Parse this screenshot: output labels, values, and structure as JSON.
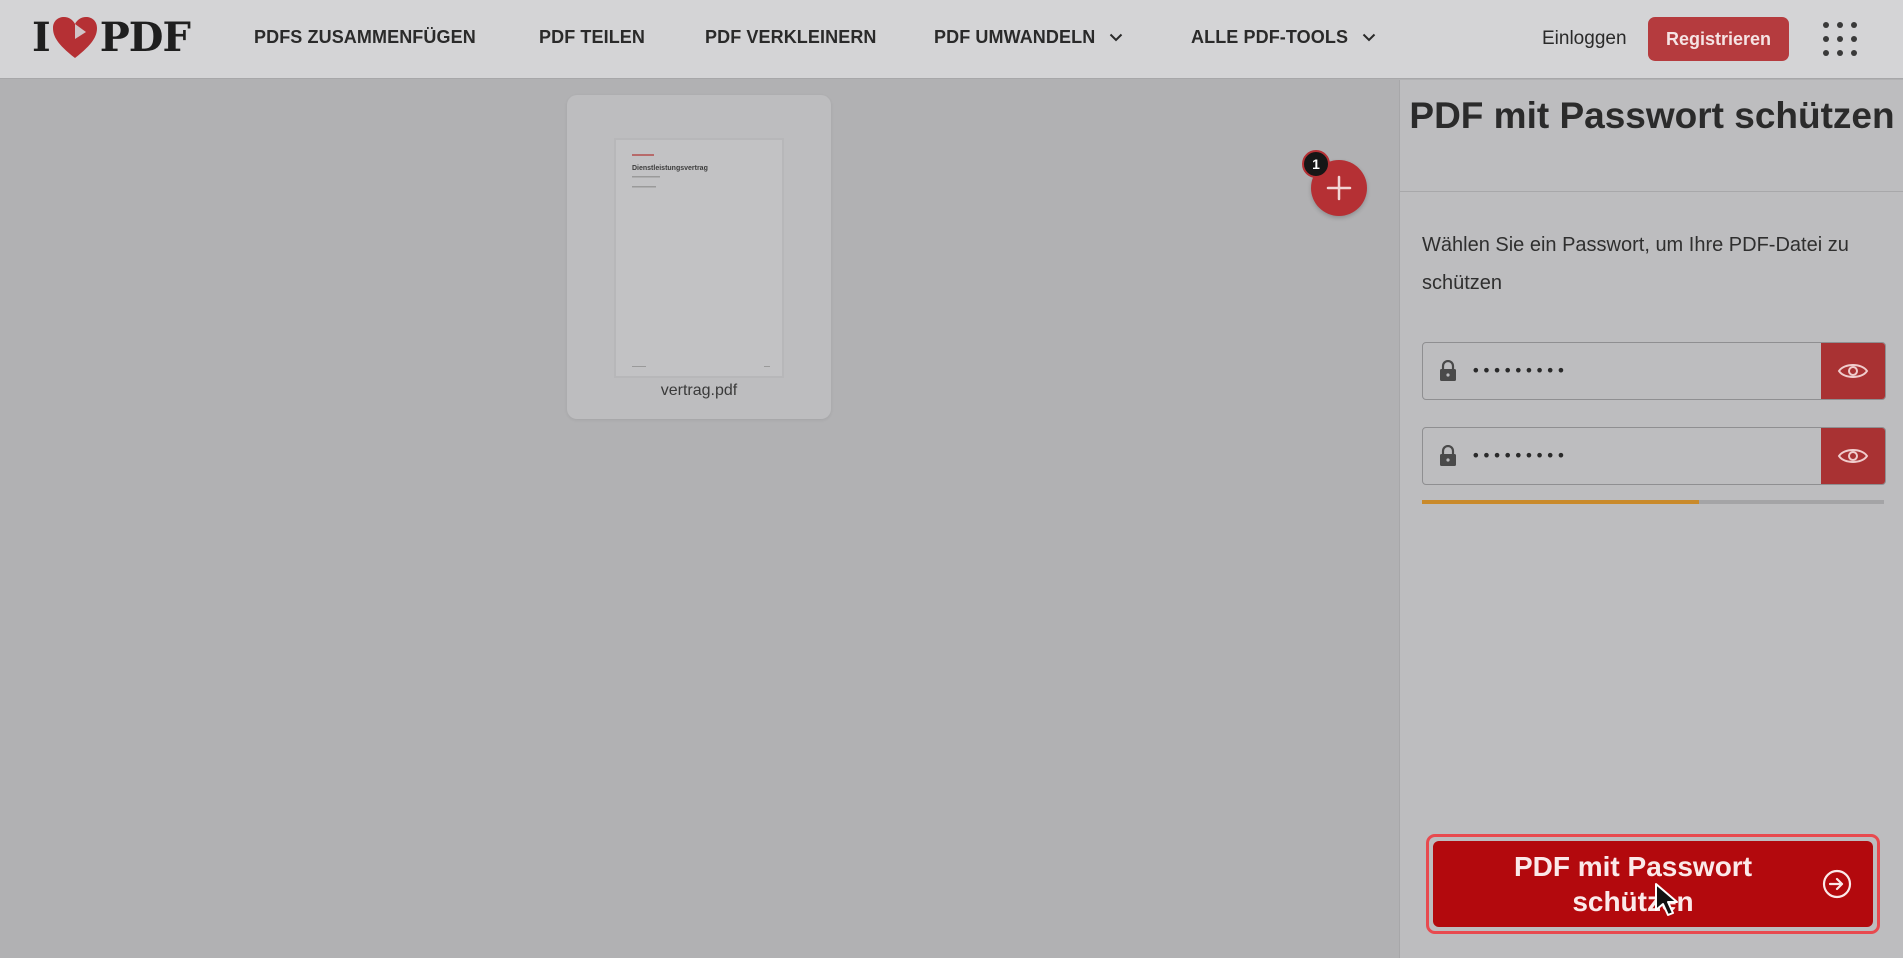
{
  "header": {
    "logo": {
      "left": "I",
      "right": "PDF"
    },
    "nav": [
      {
        "label": "PDFS ZUSAMMENFÜGEN"
      },
      {
        "label": "PDF TEILEN"
      },
      {
        "label": "PDF VERKLEINERN"
      },
      {
        "label": "PDF UMWANDELN"
      },
      {
        "label": "ALLE PDF-TOOLS"
      }
    ],
    "login_label": "Einloggen",
    "register_label": "Registrieren"
  },
  "workarea": {
    "file": {
      "name": "vertrag.pdf",
      "thumbnail_title": "Dienstleistungsvertrag"
    },
    "add_badge_count": "1"
  },
  "sidebar": {
    "title": "PDF mit Passwort schützen",
    "instruction": "Wählen Sie ein Passwort, um Ihre PDF-Datei zu schützen",
    "password_field": {
      "masked_value": "•••••••••"
    },
    "repeat_password_field": {
      "masked_value": "•••••••••"
    },
    "password_strength_fraction": 0.6,
    "submit_label": "PDF mit Passwort schützen"
  },
  "colors": {
    "brand_red": "#e5322d",
    "header_bg_dimmed": "#d4d4d6",
    "overlay_bg": "#b1b1b3",
    "strength_bar": "#c98a2b"
  }
}
